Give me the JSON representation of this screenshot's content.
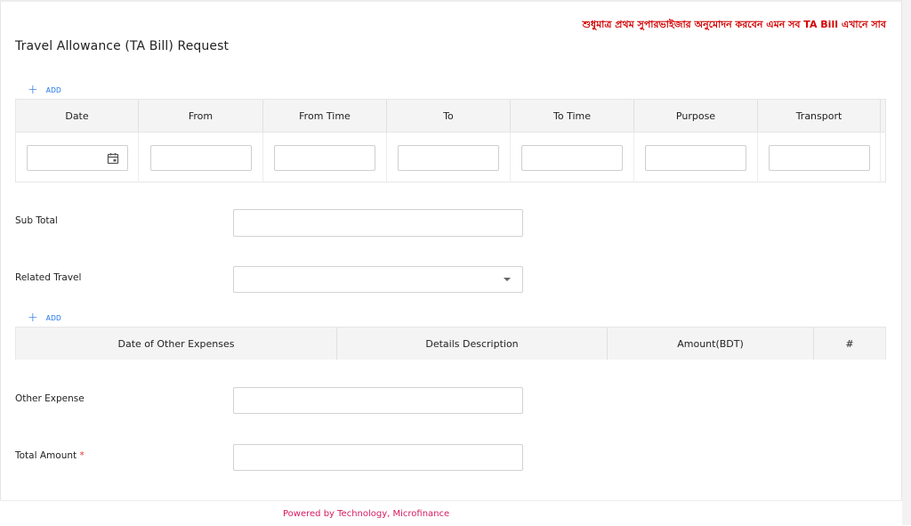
{
  "notice": "শুধুমাত্র প্রথম সুপারভাইজার অনুমোদন করবেন এমন সব TA Bill এখানে সাব",
  "page_title": "Travel Allowance (TA Bill) Request",
  "travel_table": {
    "add_label": "ADD",
    "columns": [
      "Date",
      "From",
      "From Time",
      "To",
      "To Time",
      "Purpose",
      "Transport"
    ]
  },
  "fields": {
    "sub_total": {
      "label": "Sub Total",
      "value": ""
    },
    "related_travel": {
      "label": "Related Travel",
      "value": ""
    },
    "other_expense": {
      "label": "Other Expense",
      "value": ""
    },
    "total_amount": {
      "label": "Total Amount",
      "required": "*",
      "value": ""
    }
  },
  "expense_table": {
    "add_label": "ADD",
    "columns": [
      "Date of Other Expenses",
      "Details Description",
      "Amount(BDT)",
      "#"
    ]
  },
  "footer": {
    "text": "Powered by Technology, Microfinance"
  },
  "colors": {
    "accent": "#1e73e8",
    "notice": "#d40000",
    "footer": "#d81b60",
    "required": "#e53935"
  }
}
